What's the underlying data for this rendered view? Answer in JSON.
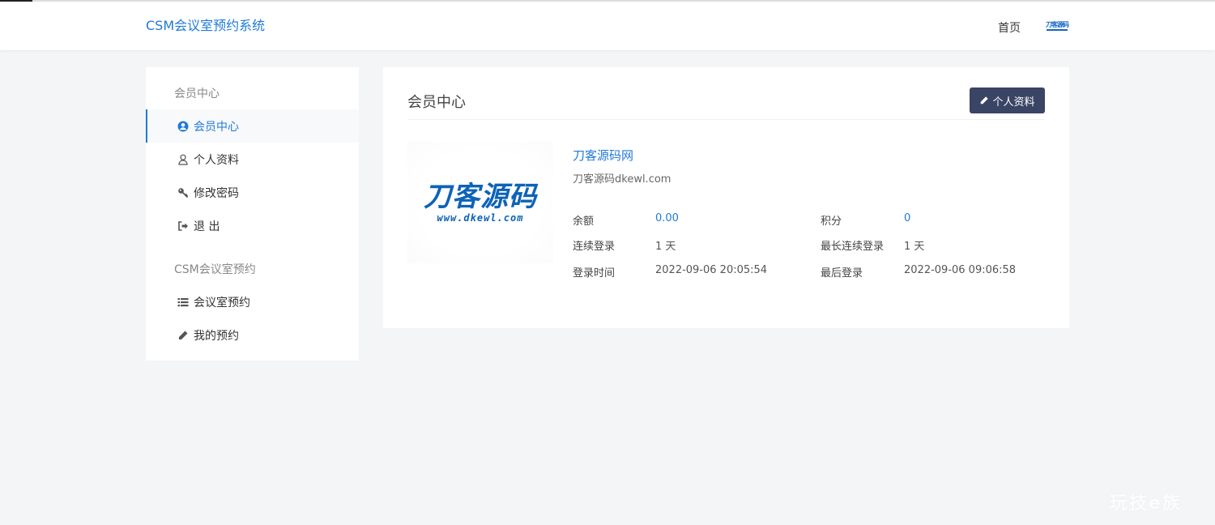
{
  "header": {
    "brand": "CSM会议室预约系统",
    "nav_home": "首页",
    "nav_logo_text": "刀客源码"
  },
  "sidebar": {
    "group1": "会员中心",
    "items1": [
      {
        "label": "会员中心",
        "icon": "user-circle-icon",
        "active": true
      },
      {
        "label": "个人资料",
        "icon": "user-icon"
      },
      {
        "label": "修改密码",
        "icon": "key-icon"
      },
      {
        "label": "退 出",
        "icon": "sign-out-icon"
      }
    ],
    "group2": "CSM会议室预约",
    "items2": [
      {
        "label": "会议室预约",
        "icon": "list-icon"
      },
      {
        "label": "我的预约",
        "icon": "pencil-icon"
      }
    ]
  },
  "panel": {
    "title": "会员中心",
    "profile_button": "个人资料",
    "avatar_text": "刀客源码",
    "avatar_url": "www.dkewl.com",
    "username": "刀客源码网",
    "subtitle": "刀客源码dkewl.com",
    "stats": [
      {
        "label": "余额",
        "value": "0.00"
      },
      {
        "label": "积分",
        "value": "0"
      },
      {
        "label": "连续登录",
        "value": "1 天"
      },
      {
        "label": "最长连续登录",
        "value": "1 天"
      },
      {
        "label": "登录时间",
        "value": "2022-09-06 20:05:54"
      },
      {
        "label": "最后登录",
        "value": "2022-09-06 09:06:58"
      }
    ]
  },
  "colors": {
    "accent": "#1f7ad6",
    "button": "#3a4464",
    "background": "#f4f5f7"
  },
  "watermark": "玩技e族"
}
